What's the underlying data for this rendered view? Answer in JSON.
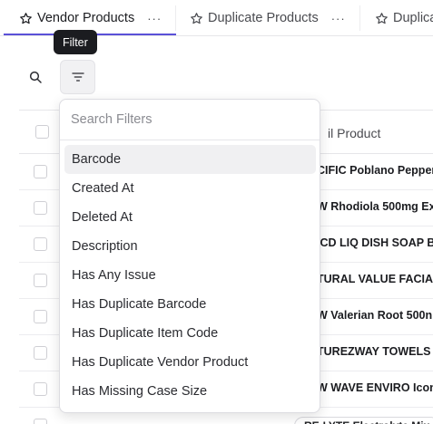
{
  "tabs": [
    {
      "label": "Vendor Products",
      "active": true
    },
    {
      "label": "Duplicate Products",
      "active": false
    },
    {
      "label": "Duplica",
      "active": false
    }
  ],
  "tab_more": "···",
  "tooltip": "Filter",
  "table": {
    "header_label": "il Product",
    "rows": [
      "CIFIC Poblano Pepper",
      "W Rhodiola 500mg Ex",
      "ICD LIQ DISH SOAP B",
      "TURAL VALUE FACIAL",
      "W Valerian Root 500n",
      "TUREZWAY TOWELS I",
      "W WAVE ENVIRO Icon"
    ],
    "partial_row": "RE-LYTE Electrolyte Mix"
  },
  "filter_menu": {
    "search_placeholder": "Search Filters",
    "options": [
      "Barcode",
      "Created At",
      "Deleted At",
      "Description",
      "Has Any Issue",
      "Has Duplicate Barcode",
      "Has Duplicate Item Code",
      "Has Duplicate Vendor Product",
      "Has Missing Case Size"
    ]
  },
  "colors": {
    "accent": "#5b51d8",
    "tooltip_bg": "#1b1c20"
  },
  "icons": [
    "star-icon",
    "search-icon",
    "filter-icon",
    "more-icon"
  ]
}
